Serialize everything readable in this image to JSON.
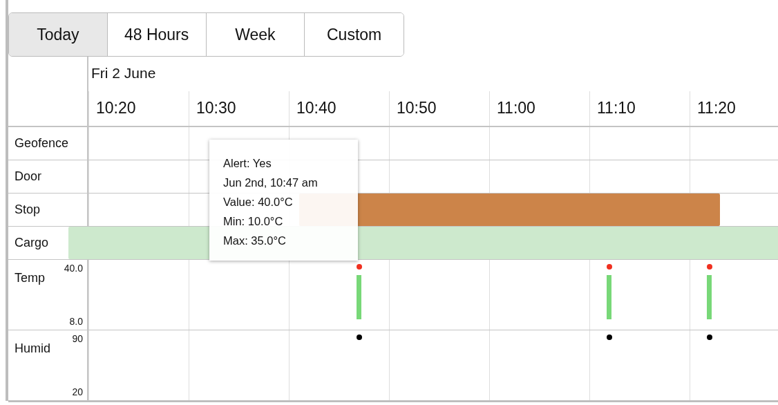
{
  "tabs": [
    {
      "label": "Today",
      "selected": true
    },
    {
      "label": "48 Hours",
      "selected": false
    },
    {
      "label": "Week",
      "selected": false
    },
    {
      "label": "Custom",
      "selected": false
    }
  ],
  "timeline": {
    "date": "Fri 2 June",
    "times": [
      "10:20",
      "10:30",
      "10:40",
      "10:50",
      "11:00",
      "11:10",
      "11:20"
    ],
    "rows": [
      {
        "label": "Geofence",
        "kind": "span"
      },
      {
        "label": "Door",
        "kind": "span"
      },
      {
        "label": "Stop",
        "kind": "span",
        "bars": [
          {
            "color": "#cc8449"
          }
        ]
      },
      {
        "label": "Cargo",
        "kind": "span",
        "bars": [
          {
            "color": "#cde9cd"
          }
        ]
      },
      {
        "label": "Temp",
        "kind": "range",
        "scale_max": "40.0",
        "scale_min": "8.0",
        "readings": [
          {
            "alert": true
          },
          {
            "alert": true
          },
          {
            "alert": true
          }
        ]
      },
      {
        "label": "Humid",
        "kind": "point",
        "scale_max": "90",
        "scale_min": "20",
        "readings": [
          {
            "alert": false
          },
          {
            "alert": false
          },
          {
            "alert": false
          }
        ]
      }
    ]
  },
  "tooltip": {
    "lines": [
      "Alert: Yes",
      "Jun 2nd, 10:47 am",
      "Value: 40.0°C",
      "Min: 10.0°C",
      "Max: 35.0°C"
    ]
  }
}
